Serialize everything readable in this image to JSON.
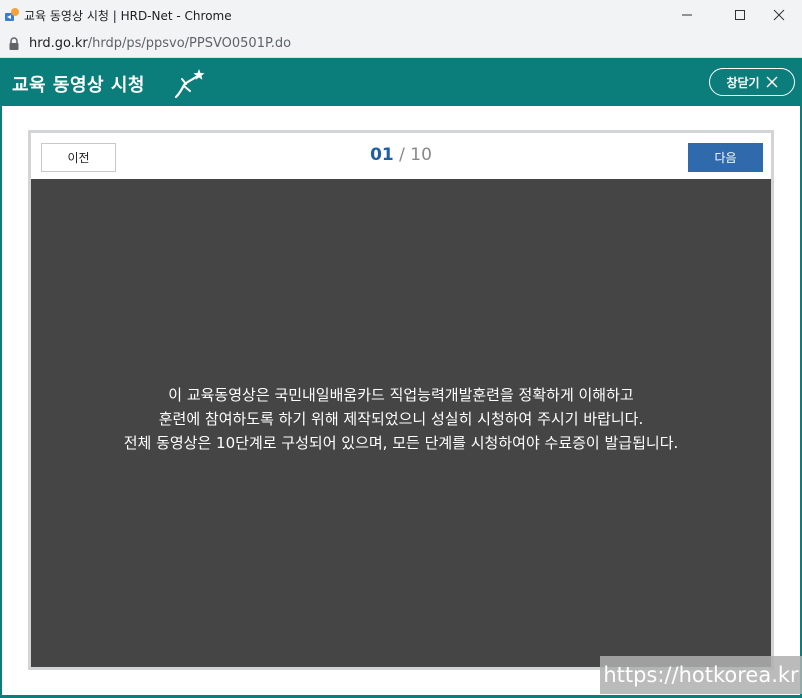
{
  "window": {
    "title": "교육 동영상 시청 | HRD-Net - Chrome"
  },
  "address": {
    "host": "hrd.go.kr",
    "path": "/hrdp/ps/ppsvo/PPSVO0501P.do"
  },
  "header": {
    "title": "교육 동영상 시청",
    "close_label": "창닫기"
  },
  "player": {
    "prev_label": "이전",
    "next_label": "다음",
    "current": "01",
    "separator": "/",
    "total": "10",
    "message_lines": [
      "이 교육동영상은 국민내일배움카드 직업능력개발훈련을 정확하게 이해하고",
      "훈련에 참여하도록 하기 위해 제작되었으니 성실히 시청하여 주시기 바랍니다.",
      "전체 동영상은 10단계로 구성되어 있으며, 모든 단계를 시청하여야 수료증이 발급됩니다."
    ]
  },
  "watermark": "https://hotkorea.kr",
  "colors": {
    "brand": "#0b7d7a",
    "next_button": "#2e6aac",
    "counter_current": "#1f5fa5",
    "video_bg": "#454545"
  },
  "icons": {
    "tab_icon": "favicon-icon",
    "lock": "lock-icon",
    "logo": "running-figure-icon",
    "close": "close-icon"
  }
}
